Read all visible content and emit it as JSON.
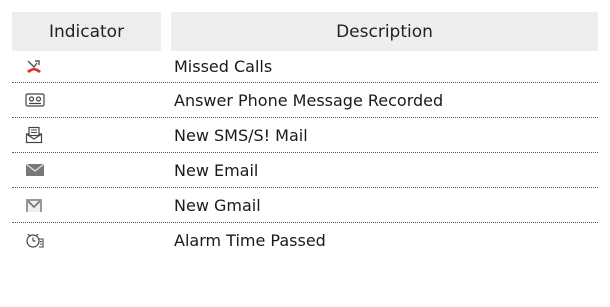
{
  "table": {
    "headers": {
      "indicator": "Indicator",
      "description": "Description"
    },
    "rows": [
      {
        "icon": "missed-call-icon",
        "description": "Missed Calls"
      },
      {
        "icon": "voicemail-icon",
        "description": "Answer Phone Message Recorded"
      },
      {
        "icon": "sms-mail-icon",
        "description": "New SMS/S! Mail"
      },
      {
        "icon": "email-icon",
        "description": "New Email"
      },
      {
        "icon": "gmail-icon",
        "description": "New Gmail"
      },
      {
        "icon": "alarm-passed-icon",
        "description": "Alarm Time Passed"
      }
    ]
  },
  "colors": {
    "header_bg": "#eeeeee",
    "missed_call_red": "#d9302c",
    "icon_gray": "#777777"
  }
}
